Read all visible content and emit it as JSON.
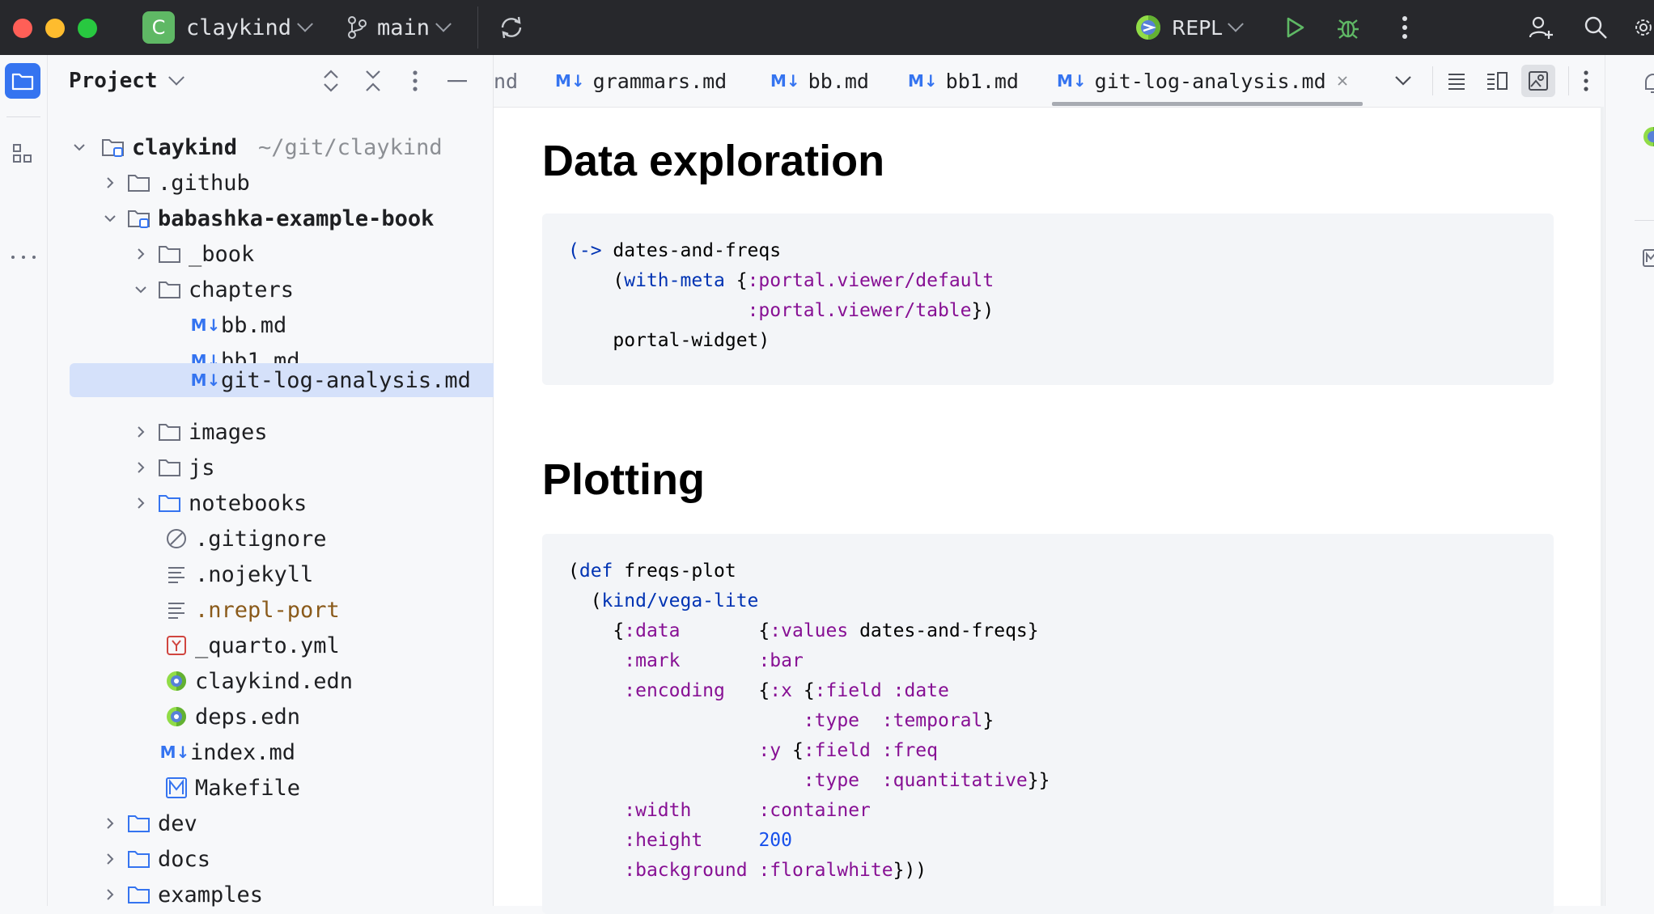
{
  "titlebar": {
    "project_badge": "C",
    "project_name": "claykind",
    "branch": "main",
    "run_config": "REPL"
  },
  "panel": {
    "title": "Project"
  },
  "tree": [
    {
      "label": "claykind",
      "hint": "~/git/claykind"
    },
    {
      "label": ".github"
    },
    {
      "label": "babashka-example-book"
    },
    {
      "label": "_book"
    },
    {
      "label": "chapters"
    },
    {
      "label": "bb.md"
    },
    {
      "label": "bb1.md"
    },
    {
      "label": "git-log-analysis.md"
    },
    {
      "label": "images"
    },
    {
      "label": "js"
    },
    {
      "label": "notebooks"
    },
    {
      "label": ".gitignore"
    },
    {
      "label": ".nojekyll"
    },
    {
      "label": ".nrepl-port"
    },
    {
      "label": "_quarto.yml"
    },
    {
      "label": "claykind.edn"
    },
    {
      "label": "deps.edn"
    },
    {
      "label": "index.md"
    },
    {
      "label": "Makefile"
    },
    {
      "label": "dev"
    },
    {
      "label": "docs"
    },
    {
      "label": "examples"
    }
  ],
  "tabs": [
    {
      "label": "nd"
    },
    {
      "label": "grammars.md",
      "badge": "M↓"
    },
    {
      "label": "bb.md",
      "badge": "M↓"
    },
    {
      "label": "bb1.md",
      "badge": "M↓"
    },
    {
      "label": "git-log-analysis.md",
      "badge": "M↓"
    }
  ],
  "editor": {
    "heading1": "Data exploration",
    "heading2": "Plotting"
  }
}
